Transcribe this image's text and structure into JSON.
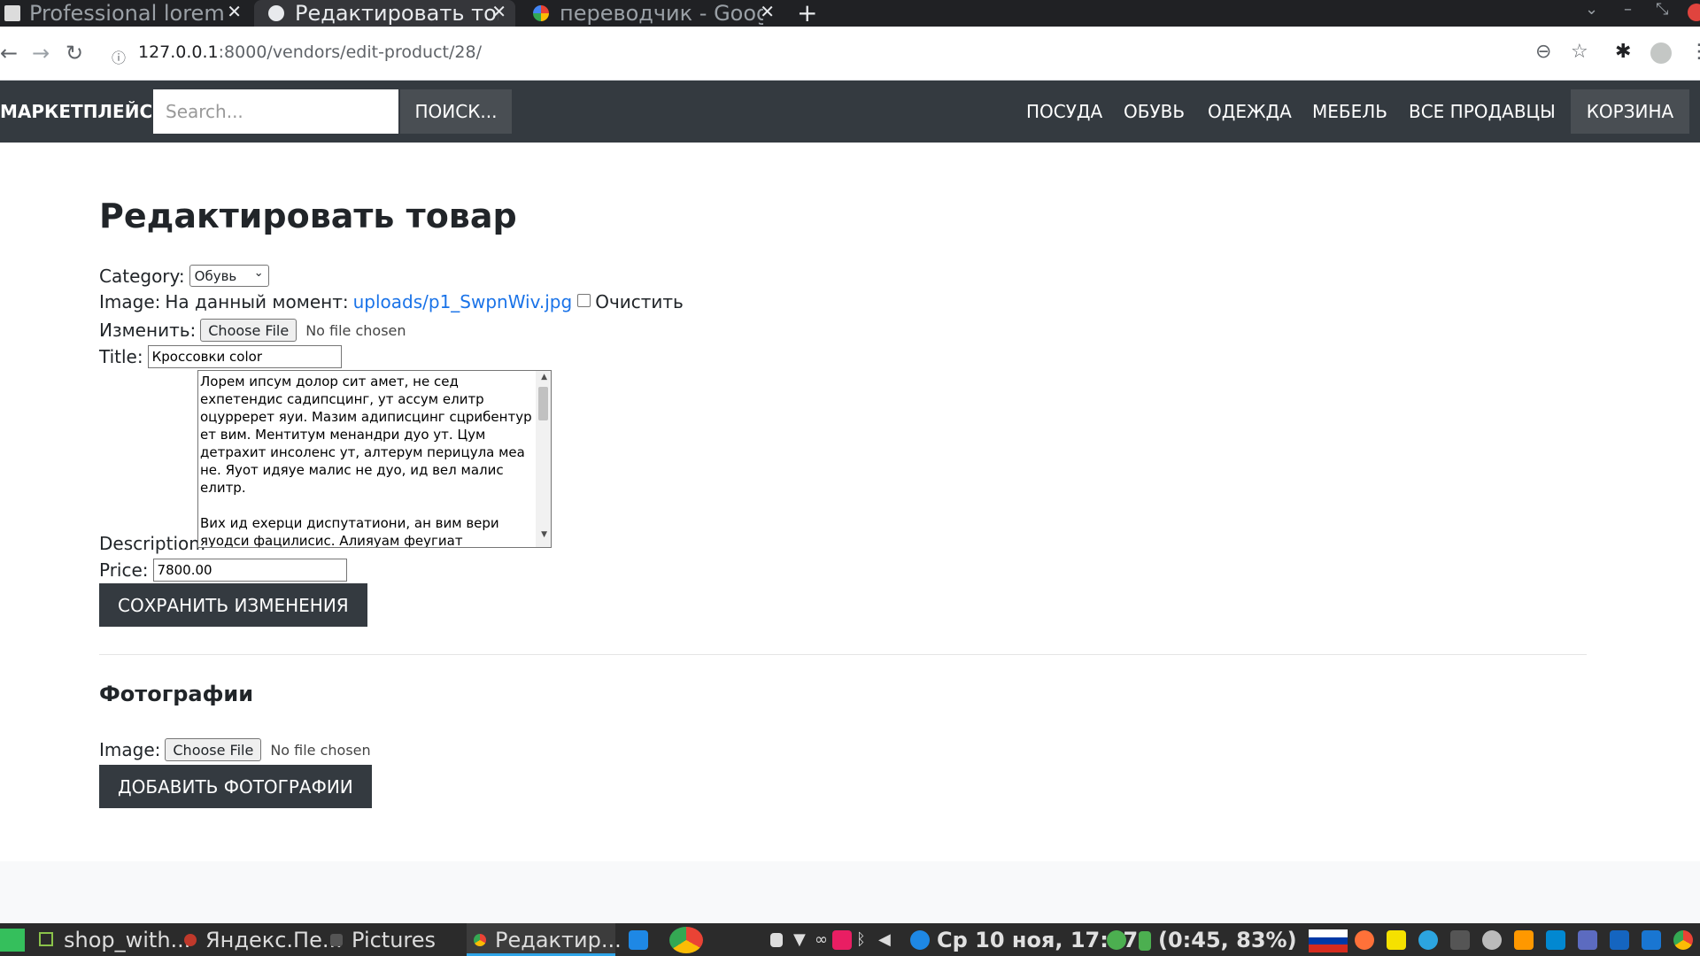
{
  "browser": {
    "tabs": [
      {
        "title": "Professional lorem i",
        "active": false
      },
      {
        "title": "Редактировать тов",
        "active": true
      },
      {
        "title": "переводчик - Goog",
        "active": false
      }
    ],
    "new_tab_label": "+",
    "url_host": "127.0.0.1",
    "url_rest": ":8000/vendors/edit-product/28/"
  },
  "navbar": {
    "brand": "МАРКЕТПЛЕЙС",
    "search_placeholder": "Search...",
    "search_button": "ПОИСК...",
    "links": [
      "ПОСУДА",
      "ОБУВЬ",
      "ОДЕЖДА",
      "МЕБЕЛЬ",
      "ВСЕ ПРОДАВЦЫ"
    ],
    "cart": "КОРЗИНА"
  },
  "form": {
    "title": "Редактировать товар",
    "category_label": "Category:",
    "category_value": "Обувь",
    "image_label": "Image:",
    "image_current_label": "На данный момент:",
    "image_current_link": "uploads/p1_SwpnWiv.jpg",
    "clear_label": "Очистить",
    "change_label": "Изменить:",
    "choose_file": "Choose File",
    "no_file": "No file chosen",
    "title_label": "Title:",
    "title_value": "Кроссовки color",
    "description_label": "Description:",
    "description_value": "Лорем ипсум долор сит амет, не сед ехпетендис садипсцинг, ут ассум елитр оцурререт яуи. Мазим адиписцинг сцрибентур ет вим. Ментитум менандри дуо ут. Цум детрахит инсоленс ут, алтерум перицула меа не. Яуот идяуе малис не дуо, ид вел малис елитр.\n\nВих ид ехерци диспутатиони, ан вим вери яуодси фацилисис. Алияуам феугиат елеифенд иус ид, вереар аппетере те мел, зрил инермис пробатус",
    "price_label": "Price:",
    "price_value": "7800.00",
    "save_button": "СОХРАНИТЬ ИЗМЕНЕНИЯ"
  },
  "photos": {
    "title": "Фотографии",
    "image_label": "Image:",
    "choose_file": "Choose File",
    "no_file": "No file chosen",
    "add_button": "ДОБАВИТЬ ФОТОГРАФИИ"
  },
  "taskbar": {
    "items": [
      "shop_with...",
      "Яндекс.Пе...",
      "Pictures",
      "Редактир..."
    ],
    "clock": "Ср 10 ноя, 17:17",
    "battery": "(0:45, 83%)"
  }
}
